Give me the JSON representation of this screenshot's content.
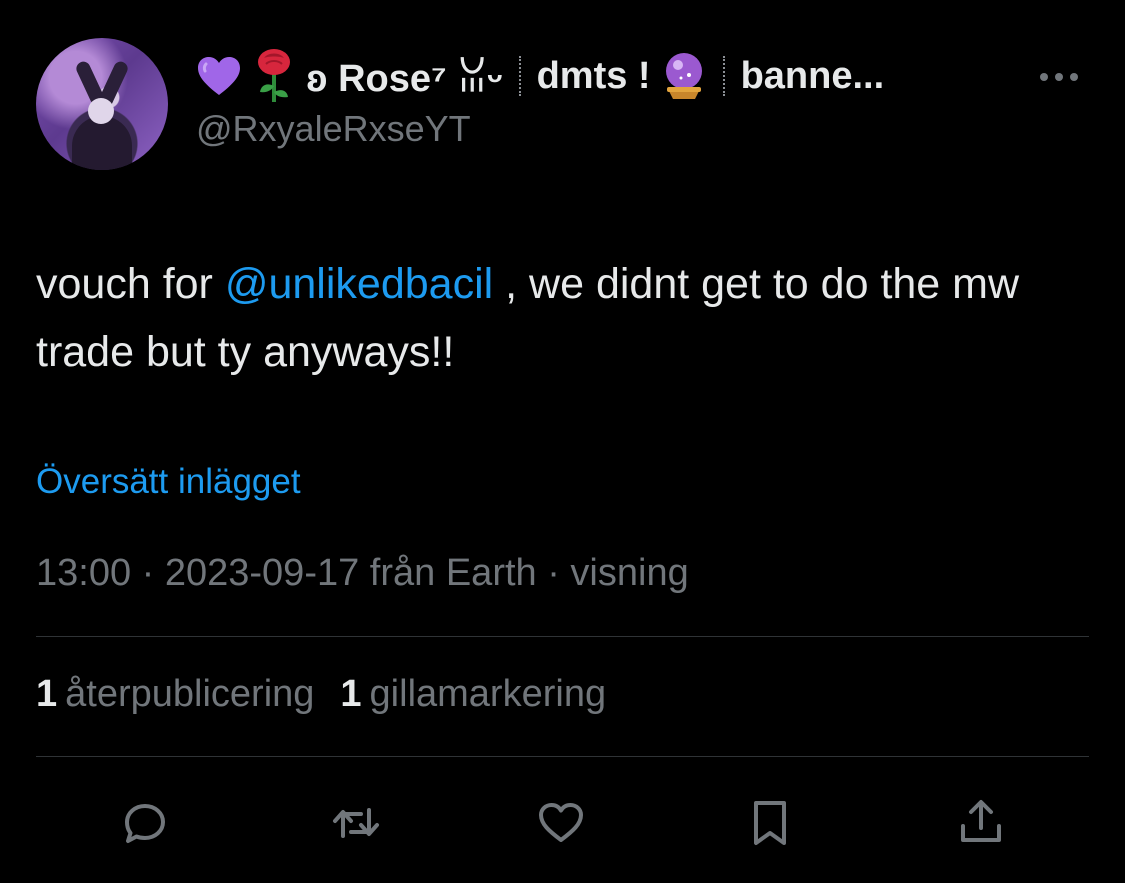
{
  "header": {
    "display_name_parts": {
      "heart": "💜",
      "rose": "🌹",
      "name": "ʚ Rose⁷ ꈍᵕ",
      "dmts": "dmts !",
      "crystal_ball": "🔮",
      "banner": "banne..."
    },
    "handle": "@RxyaleRxseYT"
  },
  "tweet": {
    "text_before": "vouch for ",
    "mention": "@unlikedbacil",
    "text_after": " , we didnt get to do the mw trade but ty anyways!!",
    "translate_label": "Översätt inlägget",
    "meta": "13:00 · 2023-09-17 från Earth · visning"
  },
  "stats": {
    "reposts_count": "1",
    "reposts_label": "återpublicering",
    "likes_count": "1",
    "likes_label": "gillamarkering"
  },
  "actions": [
    {
      "icon": "reply-icon"
    },
    {
      "icon": "repost-icon"
    },
    {
      "icon": "like-icon"
    },
    {
      "icon": "bookmark-icon"
    },
    {
      "icon": "share-icon"
    }
  ],
  "colors": {
    "background": "#000000",
    "text": "#e7e9ea",
    "secondary": "#71767b",
    "accent": "#1d9bf0",
    "divider": "#2f3336"
  }
}
